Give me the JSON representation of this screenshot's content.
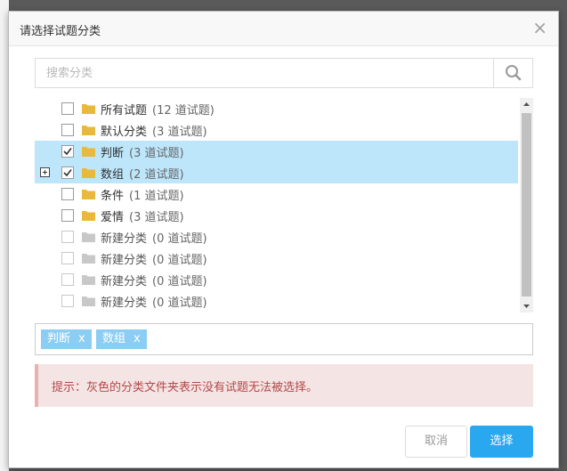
{
  "dialog": {
    "title": "请选择试题分类",
    "close_label": "×"
  },
  "search": {
    "placeholder": "搜索分类",
    "icon": "search-icon"
  },
  "tree": {
    "nodes": [
      {
        "label": "所有试题",
        "count": "(12 道试题)",
        "checked": false,
        "selected": false,
        "disabled": false,
        "expandable": false
      },
      {
        "label": "默认分类",
        "count": "(3 道试题)",
        "checked": false,
        "selected": false,
        "disabled": false,
        "expandable": false
      },
      {
        "label": "判断",
        "count": "(3 道试题)",
        "checked": true,
        "selected": true,
        "disabled": false,
        "expandable": false
      },
      {
        "label": "数组",
        "count": "(2 道试题)",
        "checked": true,
        "selected": true,
        "disabled": false,
        "expandable": true
      },
      {
        "label": "条件",
        "count": "(1 道试题)",
        "checked": false,
        "selected": false,
        "disabled": false,
        "expandable": false
      },
      {
        "label": "爱情",
        "count": "(3 道试题)",
        "checked": false,
        "selected": false,
        "disabled": false,
        "expandable": false
      },
      {
        "label": "新建分类",
        "count": "(0 道试题)",
        "checked": false,
        "selected": false,
        "disabled": true,
        "expandable": false
      },
      {
        "label": "新建分类",
        "count": "(0 道试题)",
        "checked": false,
        "selected": false,
        "disabled": true,
        "expandable": false
      },
      {
        "label": "新建分类",
        "count": "(0 道试题)",
        "checked": false,
        "selected": false,
        "disabled": true,
        "expandable": false
      },
      {
        "label": "新建分类",
        "count": "(0 道试题)",
        "checked": false,
        "selected": false,
        "disabled": true,
        "expandable": false
      }
    ]
  },
  "selected_tags": [
    {
      "label": "判断",
      "remove": "x"
    },
    {
      "label": "数组",
      "remove": "x"
    }
  ],
  "alert": {
    "text": "提示：灰色的分类文件夹表示没有试题无法被选择。"
  },
  "buttons": {
    "cancel_label": "取消",
    "confirm_label": "选择"
  },
  "colors": {
    "folder_active": "#e8b93c",
    "folder_disabled": "#c8c8c8",
    "selected_row": "#bde6fb",
    "tag": "#8ccdf3",
    "primary": "#29a8f0",
    "alert_bg": "#f5e4e4",
    "alert_text": "#b34848"
  }
}
